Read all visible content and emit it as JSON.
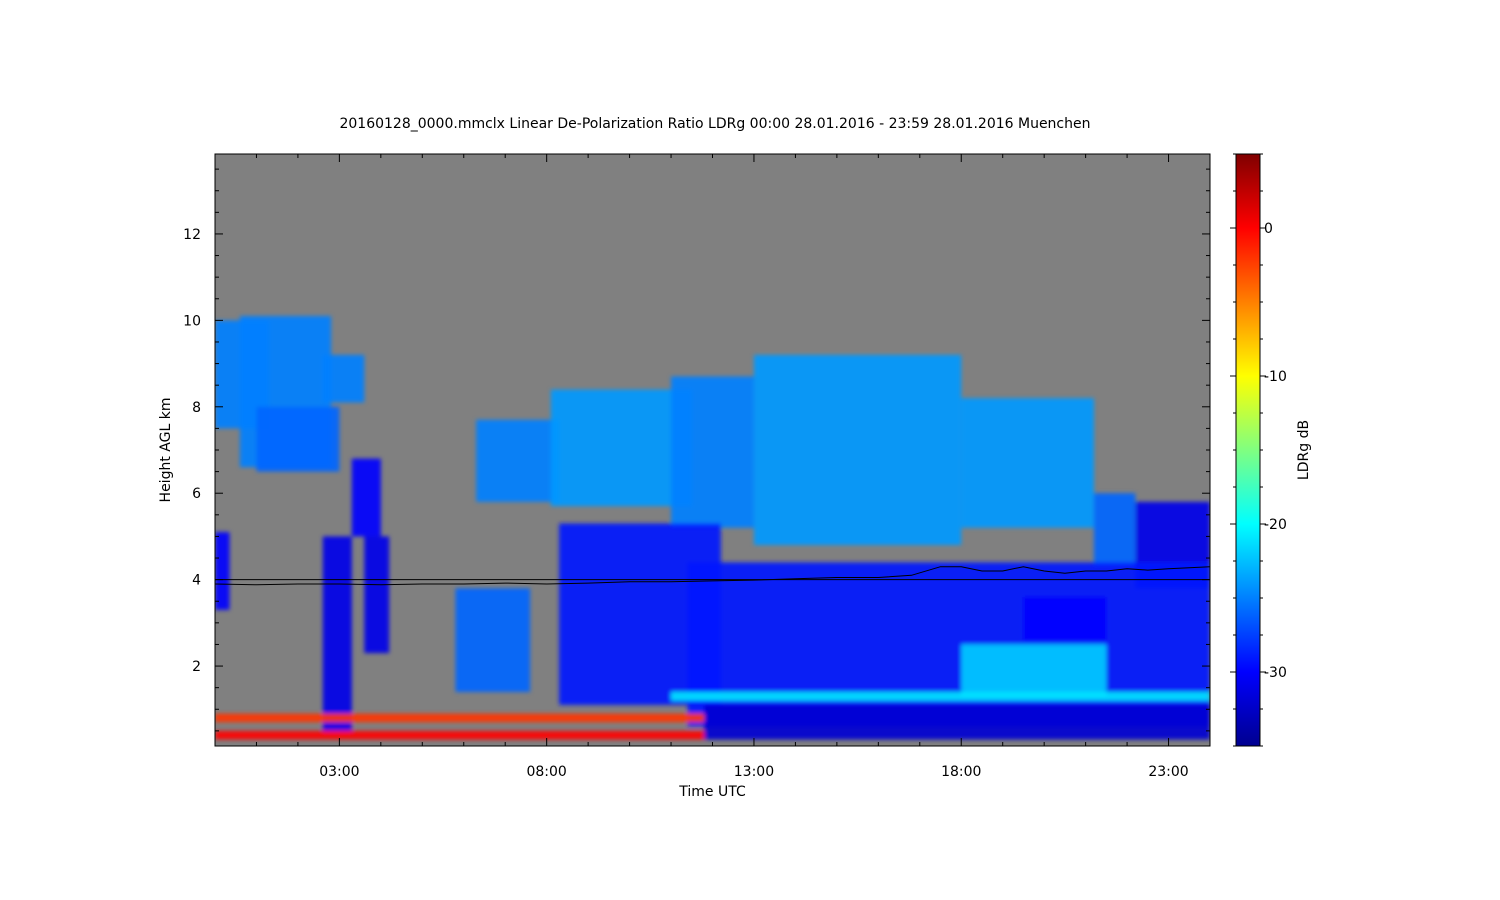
{
  "chart_data": {
    "type": "heatmap",
    "title": "20160128_0000.mmclx Linear De-Polarization Ratio LDRg   00:00 28.01.2016 - 23:59 28.01.2016 Muenchen",
    "xlabel": "Time UTC",
    "ylabel": "Height AGL km",
    "colorbar_label": "LDRg dB",
    "xlim": [
      0.0,
      24.0
    ],
    "ylim": [
      0.15,
      13.85
    ],
    "x_ticks": [
      {
        "value": 3,
        "label": "03:00"
      },
      {
        "value": 8,
        "label": "08:00"
      },
      {
        "value": 13,
        "label": "13:00"
      },
      {
        "value": 18,
        "label": "18:00"
      },
      {
        "value": 23,
        "label": "23:00"
      }
    ],
    "y_ticks": [
      {
        "value": 2,
        "label": "2"
      },
      {
        "value": 4,
        "label": "4"
      },
      {
        "value": 6,
        "label": "6"
      },
      {
        "value": 8,
        "label": "8"
      },
      {
        "value": 10,
        "label": "10"
      },
      {
        "value": 12,
        "label": "12"
      }
    ],
    "colorbar_range": [
      -35,
      5
    ],
    "colorbar_ticks": [
      {
        "value": 0,
        "label": "0"
      },
      {
        "value": -10,
        "label": "-10"
      },
      {
        "value": -20,
        "label": "-20"
      },
      {
        "value": -30,
        "label": "-30"
      }
    ],
    "colormap": [
      "#00008f",
      "#0000ff",
      "#0080ff",
      "#00ffff",
      "#80ff80",
      "#ffff00",
      "#ff8000",
      "#ff0000",
      "#800000"
    ],
    "background_color": "#808080",
    "no_signal_color": "#808080",
    "reference_line_height": 4.0,
    "melting_layer_line": [
      [
        0.0,
        3.9
      ],
      [
        1.0,
        3.88
      ],
      [
        2.0,
        3.9
      ],
      [
        3.0,
        3.9
      ],
      [
        4.0,
        3.88
      ],
      [
        5.0,
        3.9
      ],
      [
        6.0,
        3.9
      ],
      [
        7.0,
        3.92
      ],
      [
        8.0,
        3.9
      ],
      [
        9.0,
        3.92
      ],
      [
        10.0,
        3.95
      ],
      [
        11.0,
        3.95
      ],
      [
        12.0,
        3.97
      ],
      [
        13.0,
        3.99
      ],
      [
        14.0,
        4.02
      ],
      [
        15.0,
        4.05
      ],
      [
        16.0,
        4.05
      ],
      [
        16.8,
        4.1
      ],
      [
        17.5,
        4.3
      ],
      [
        18.0,
        4.3
      ],
      [
        18.5,
        4.2
      ],
      [
        19.0,
        4.2
      ],
      [
        19.5,
        4.3
      ],
      [
        20.0,
        4.2
      ],
      [
        20.5,
        4.15
      ],
      [
        21.0,
        4.2
      ],
      [
        21.5,
        4.2
      ],
      [
        22.0,
        4.25
      ],
      [
        22.5,
        4.22
      ],
      [
        23.0,
        4.25
      ],
      [
        24.0,
        4.3
      ]
    ],
    "regions": [
      {
        "t0": 0.0,
        "t1": 1.3,
        "h0": 7.5,
        "h1": 10.0,
        "ldr": -25
      },
      {
        "t0": 0.6,
        "t1": 2.8,
        "h0": 6.6,
        "h1": 10.1,
        "ldr": -25
      },
      {
        "t0": 1.0,
        "t1": 3.0,
        "h0": 6.5,
        "h1": 8.0,
        "ldr": -26
      },
      {
        "t0": 2.6,
        "t1": 3.6,
        "h0": 8.1,
        "h1": 9.2,
        "ldr": -25
      },
      {
        "t0": 0.0,
        "t1": 0.35,
        "h0": 3.3,
        "h1": 5.1,
        "ldr": -30
      },
      {
        "t0": 2.6,
        "t1": 3.3,
        "h0": 0.5,
        "h1": 5.0,
        "ldr": -31
      },
      {
        "t0": 3.3,
        "t1": 4.0,
        "h0": 5.0,
        "h1": 6.8,
        "ldr": -30
      },
      {
        "t0": 3.6,
        "t1": 4.2,
        "h0": 2.3,
        "h1": 5.0,
        "ldr": -31
      },
      {
        "t0": 6.3,
        "t1": 8.3,
        "h0": 5.8,
        "h1": 7.7,
        "ldr": -25
      },
      {
        "t0": 8.1,
        "t1": 11.5,
        "h0": 5.7,
        "h1": 8.4,
        "ldr": -24
      },
      {
        "t0": 11.0,
        "t1": 13.0,
        "h0": 5.2,
        "h1": 8.7,
        "ldr": -25
      },
      {
        "t0": 13.0,
        "t1": 18.0,
        "h0": 4.8,
        "h1": 9.2,
        "ldr": -24
      },
      {
        "t0": 18.0,
        "t1": 21.2,
        "h0": 5.2,
        "h1": 8.2,
        "ldr": -24
      },
      {
        "t0": 21.2,
        "t1": 22.2,
        "h0": 4.3,
        "h1": 6.0,
        "ldr": -26
      },
      {
        "t0": 22.2,
        "t1": 24.0,
        "h0": 3.8,
        "h1": 5.8,
        "ldr": -31
      },
      {
        "t0": 5.8,
        "t1": 7.6,
        "h0": 1.4,
        "h1": 3.8,
        "ldr": -26
      },
      {
        "t0": 8.3,
        "t1": 12.2,
        "h0": 1.1,
        "h1": 5.3,
        "ldr": -29
      },
      {
        "t0": 11.4,
        "t1": 24.0,
        "h0": 0.6,
        "h1": 4.4,
        "ldr": -29
      },
      {
        "t0": 18.0,
        "t1": 21.5,
        "h0": 1.3,
        "h1": 2.5,
        "ldr": -22
      },
      {
        "t0": 19.5,
        "t1": 21.5,
        "h0": 2.6,
        "h1": 3.6,
        "ldr": -30
      },
      {
        "t0": 11.0,
        "t1": 24.0,
        "h0": 1.2,
        "h1": 1.4,
        "ldr": -21
      },
      {
        "t0": 11.8,
        "t1": 24.0,
        "h0": 0.3,
        "h1": 1.1,
        "ldr": -32
      },
      {
        "t0": 0.0,
        "t1": 11.8,
        "h0": 0.3,
        "h1": 0.5,
        "ldr": 0
      },
      {
        "t0": 0.0,
        "t1": 11.8,
        "h0": 0.7,
        "h1": 0.9,
        "ldr": -2
      }
    ]
  }
}
